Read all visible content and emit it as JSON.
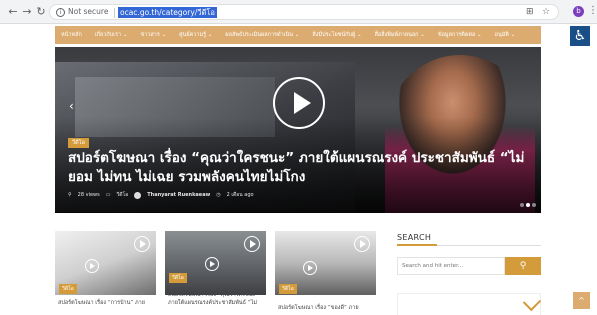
{
  "browser": {
    "secure_label": "Not secure",
    "url": "ocac.go.th/category/วีดีโอ",
    "back_icon": "back-arrow-icon",
    "forward_icon": "forward-arrow-icon",
    "reload_icon": "reload-icon",
    "profile_initial": "b"
  },
  "nav": {
    "items": [
      {
        "label": "หน้าหลัก"
      },
      {
        "label": "เกี่ยวกับเรา ⌄"
      },
      {
        "label": "ข่าวสาร ⌄"
      },
      {
        "label": "ศูนย์ความรู้ ⌄"
      },
      {
        "label": "ผลลัพธ์ประเมินผลการดำเนิน ⌄"
      },
      {
        "label": "สิ่งมีประโยชน์กับผู้ ⌄"
      },
      {
        "label": "สื่อสิ่งพิมพ์ภายนอก ⌄"
      },
      {
        "label": "ข้อมูลการติดต่อ ⌄"
      },
      {
        "label": "อนุมัติ ⌄"
      }
    ],
    "accessibility_icon": "wheelchair-icon"
  },
  "hero": {
    "tag": "วีดีโอ",
    "title": "สปอร์ตโฆษณา เรื่อง “คุณว่าใครชนะ” ภายใต้แผนรณรงค์ ประชาสัมพันธ์ “ไม่ยอม ไม่ทน ไม่เฉย รวมพลังคนไทยไม่โกง",
    "views": "28 views",
    "category": "วีดีโอ",
    "author": "Thanyarat Ruenkaeaw",
    "time": "2 เดือน ago"
  },
  "cards": [
    {
      "tag": "วีดีโอ",
      "title": "สปอร์ตโฆษณา เรื่อง “การบ้าน” ภาย"
    },
    {
      "tag": "วีดีโอ",
      "title": "สปอร์ตโฆษณา เรื่อง “คุณว่าใครชนะ” ภายใต้แผนรณรงค์ประชาสัมพันธ์ “ไม่"
    },
    {
      "tag": "วีดีโอ",
      "title": "สปอร์ตโฆษณา เรื่อง “ของดี” ภาย"
    }
  ],
  "sidebar": {
    "title": "SEARCH",
    "search_placeholder": "Search and hit enter...",
    "search_icon": "search-icon"
  },
  "colors": {
    "accent": "#d49b3b",
    "nav_bar": "#dcab6f",
    "accessibility": "#1a4e86"
  }
}
